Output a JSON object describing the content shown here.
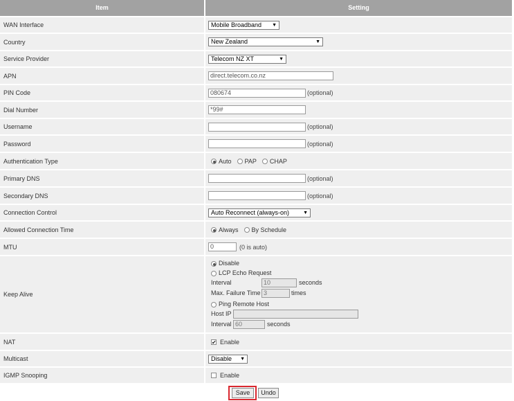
{
  "header": {
    "item": "Item",
    "setting": "Setting"
  },
  "wan_interface": {
    "label": "WAN Interface",
    "value": "Mobile Broadband"
  },
  "country": {
    "label": "Country",
    "value": "New Zealand"
  },
  "service_provider": {
    "label": "Service Provider",
    "value": "Telecom NZ XT"
  },
  "apn": {
    "label": "APN",
    "value": "direct.telecom.co.nz"
  },
  "pin_code": {
    "label": "PIN Code",
    "value": "080674",
    "note": "(optional)"
  },
  "dial_number": {
    "label": "Dial Number",
    "value": "*99#"
  },
  "username": {
    "label": "Username",
    "value": "",
    "note": "(optional)"
  },
  "password": {
    "label": "Password",
    "value": "",
    "note": "(optional)"
  },
  "auth_type": {
    "label": "Authentication Type",
    "options": [
      "Auto",
      "PAP",
      "CHAP"
    ],
    "selected": "Auto"
  },
  "primary_dns": {
    "label": "Primary DNS",
    "value": "",
    "note": "(optional)"
  },
  "secondary_dns": {
    "label": "Secondary DNS",
    "value": "",
    "note": "(optional)"
  },
  "connection_control": {
    "label": "Connection Control",
    "value": "Auto Reconnect (always-on)"
  },
  "allowed_time": {
    "label": "Allowed Connection Time",
    "options": [
      "Always",
      "By Schedule"
    ],
    "selected": "Always"
  },
  "mtu": {
    "label": "MTU",
    "value": "0",
    "note": "(0 is auto)"
  },
  "keep_alive": {
    "label": "Keep Alive",
    "disable": "Disable",
    "lcp": "LCP Echo Request",
    "interval_label": "Interval",
    "lcp_interval": "10",
    "seconds": "seconds",
    "max_failure_label": "Max. Failure Time",
    "max_failure": "3",
    "times": "times",
    "ping": "Ping Remote Host",
    "host_ip_label": "Host IP",
    "host_ip": "",
    "ping_interval": "60",
    "selected": "Disable"
  },
  "nat": {
    "label": "NAT",
    "option": "Enable",
    "checked": true
  },
  "multicast": {
    "label": "Multicast",
    "value": "Disable"
  },
  "igmp": {
    "label": "IGMP Snooping",
    "option": "Enable",
    "checked": false
  },
  "buttons": {
    "save": "Save",
    "undo": "Undo"
  },
  "icons": {
    "dropdown": "▼",
    "check": "✔"
  },
  "colors": {
    "header_bg": "#a2a2a2",
    "row_bg": "#efefef",
    "highlight": "#d9262e"
  }
}
